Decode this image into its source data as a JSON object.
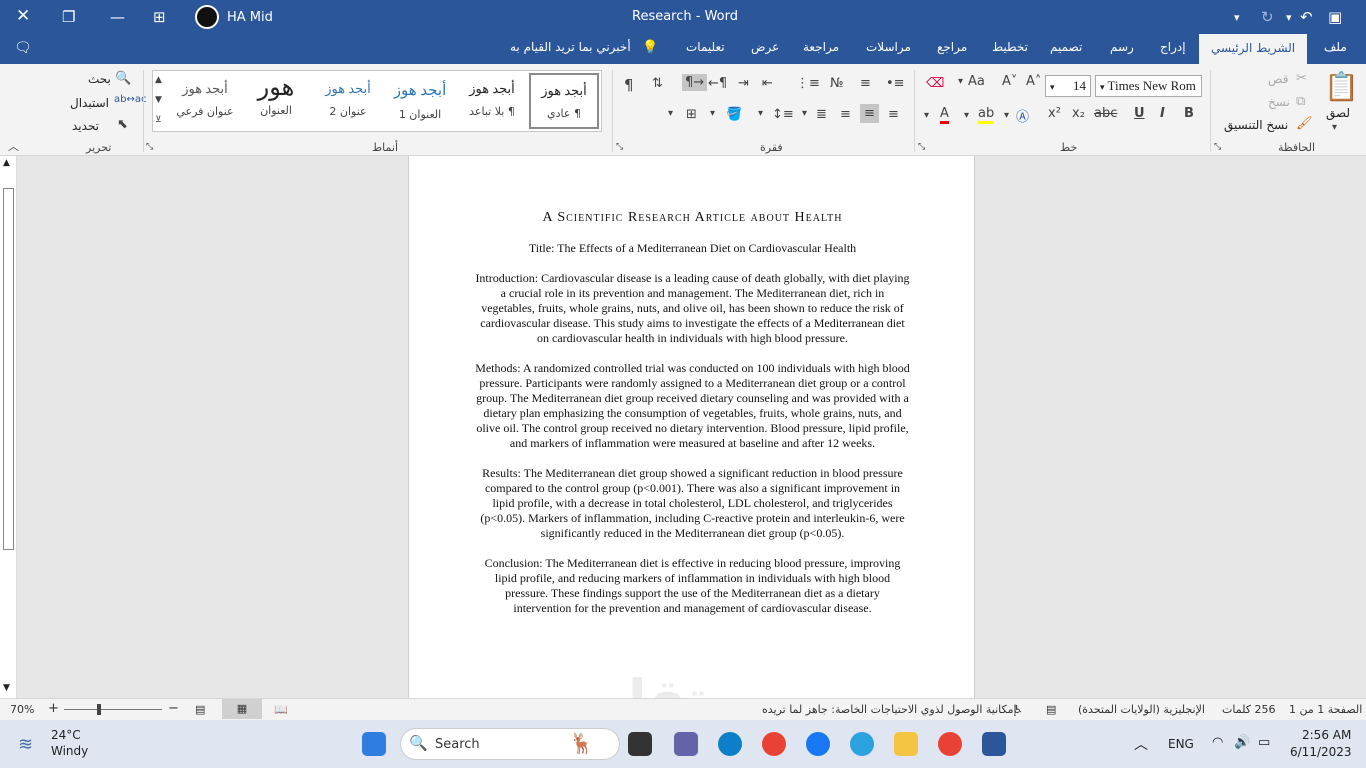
{
  "window": {
    "title": "Research  -  Word",
    "user_name": "HA Mid"
  },
  "ribbon_tabs": [
    "ملف",
    "الشريط الرئيسي",
    "إدراج",
    "رسم",
    "تصميم",
    "تخطيط",
    "مراجع",
    "مراسلات",
    "مراجعة",
    "عرض",
    "تعليمات",
    "أخبرني بما تريد القيام به"
  ],
  "ribbon": {
    "clipboard": {
      "paste": "لصق",
      "cut": "قص",
      "copy": "نسخ",
      "format_painter": "نسخ التنسيق",
      "label": "الحافظة"
    },
    "font": {
      "name": "Times New Rom",
      "size": "14",
      "label": "خط"
    },
    "paragraph": {
      "label": "فقرة"
    },
    "styles": {
      "label": "أنماط",
      "items": [
        {
          "sample": "أبجد هوز",
          "name": "¶ عادي"
        },
        {
          "sample": "أبجد هوز",
          "name": "¶ بلا تباعد"
        },
        {
          "sample": "أبجد هوز",
          "name": "العنوان 1"
        },
        {
          "sample": "أبجد هوز",
          "name": "عنوان 2"
        },
        {
          "sample": "هور",
          "name": "العنوان"
        },
        {
          "sample": "أبجد هوز",
          "name": "عنوان فرعي"
        }
      ]
    },
    "editing": {
      "find": "بحث",
      "replace": "استبدال",
      "select": "تحديد",
      "label": "تحرير"
    }
  },
  "document": {
    "heading": "A Scientific Research Article about Health",
    "title": "Title: The Effects of a Mediterranean Diet on Cardiovascular Health",
    "introduction": "Introduction: Cardiovascular disease is a leading cause of death globally, with diet playing a crucial role in its prevention and management. The Mediterranean diet, rich in vegetables, fruits, whole grains, nuts, and olive oil, has been shown to reduce the risk of cardiovascular disease. This study aims to investigate the effects of a Mediterranean diet on cardiovascular health in individuals with high blood pressure.",
    "methods": "Methods: A randomized controlled trial was conducted on 100 individuals with high blood pressure. Participants were randomly assigned to a Mediterranean diet group or a control group. The Mediterranean diet group received dietary counseling and was provided with a dietary plan emphasizing the consumption of vegetables, fruits, whole grains, nuts, and olive oil. The control group received no dietary intervention. Blood pressure, lipid profile, and markers of inflammation were measured at baseline and after 12 weeks.",
    "results": "Results: The Mediterranean diet group showed a significant reduction in blood pressure compared to the control group (p<0.001). There was also a significant improvement in lipid profile, with a decrease in total cholesterol, LDL cholesterol, and triglycerides (p<0.05). Markers of inflammation, including C-reactive protein and interleukin-6, were significantly reduced in the Mediterranean diet group (p<0.05).",
    "conclusion": "Conclusion: The Mediterranean diet is effective in reducing blood pressure, improving lipid profile, and reducing markers of inflammation in individuals with high blood pressure. These findings support the use of the Mediterranean diet as a dietary intervention for the prevention and management of cardiovascular disease."
  },
  "status": {
    "page": "الصفحة 1 من 1",
    "words": "256 كلمات",
    "language": "الإنجليزية (الولايات المتحدة)",
    "accessibility": "إمكانية الوصول لذوي الاحتياجات الخاصة: جاهز لما تريده",
    "zoom": "70%",
    "zoom_fraction": 0.7
  },
  "taskbar": {
    "weather_temp": "24°C",
    "weather_desc": "Windy",
    "search_placeholder": "Search",
    "lang": "ENG",
    "time": "2:56 AM",
    "date": "6/11/2023"
  },
  "watermark": "مستقل",
  "colors": {
    "accent": "#2b579a",
    "ribbon_bg": "#f3f3f3",
    "workspace": "#e6e6e6"
  }
}
